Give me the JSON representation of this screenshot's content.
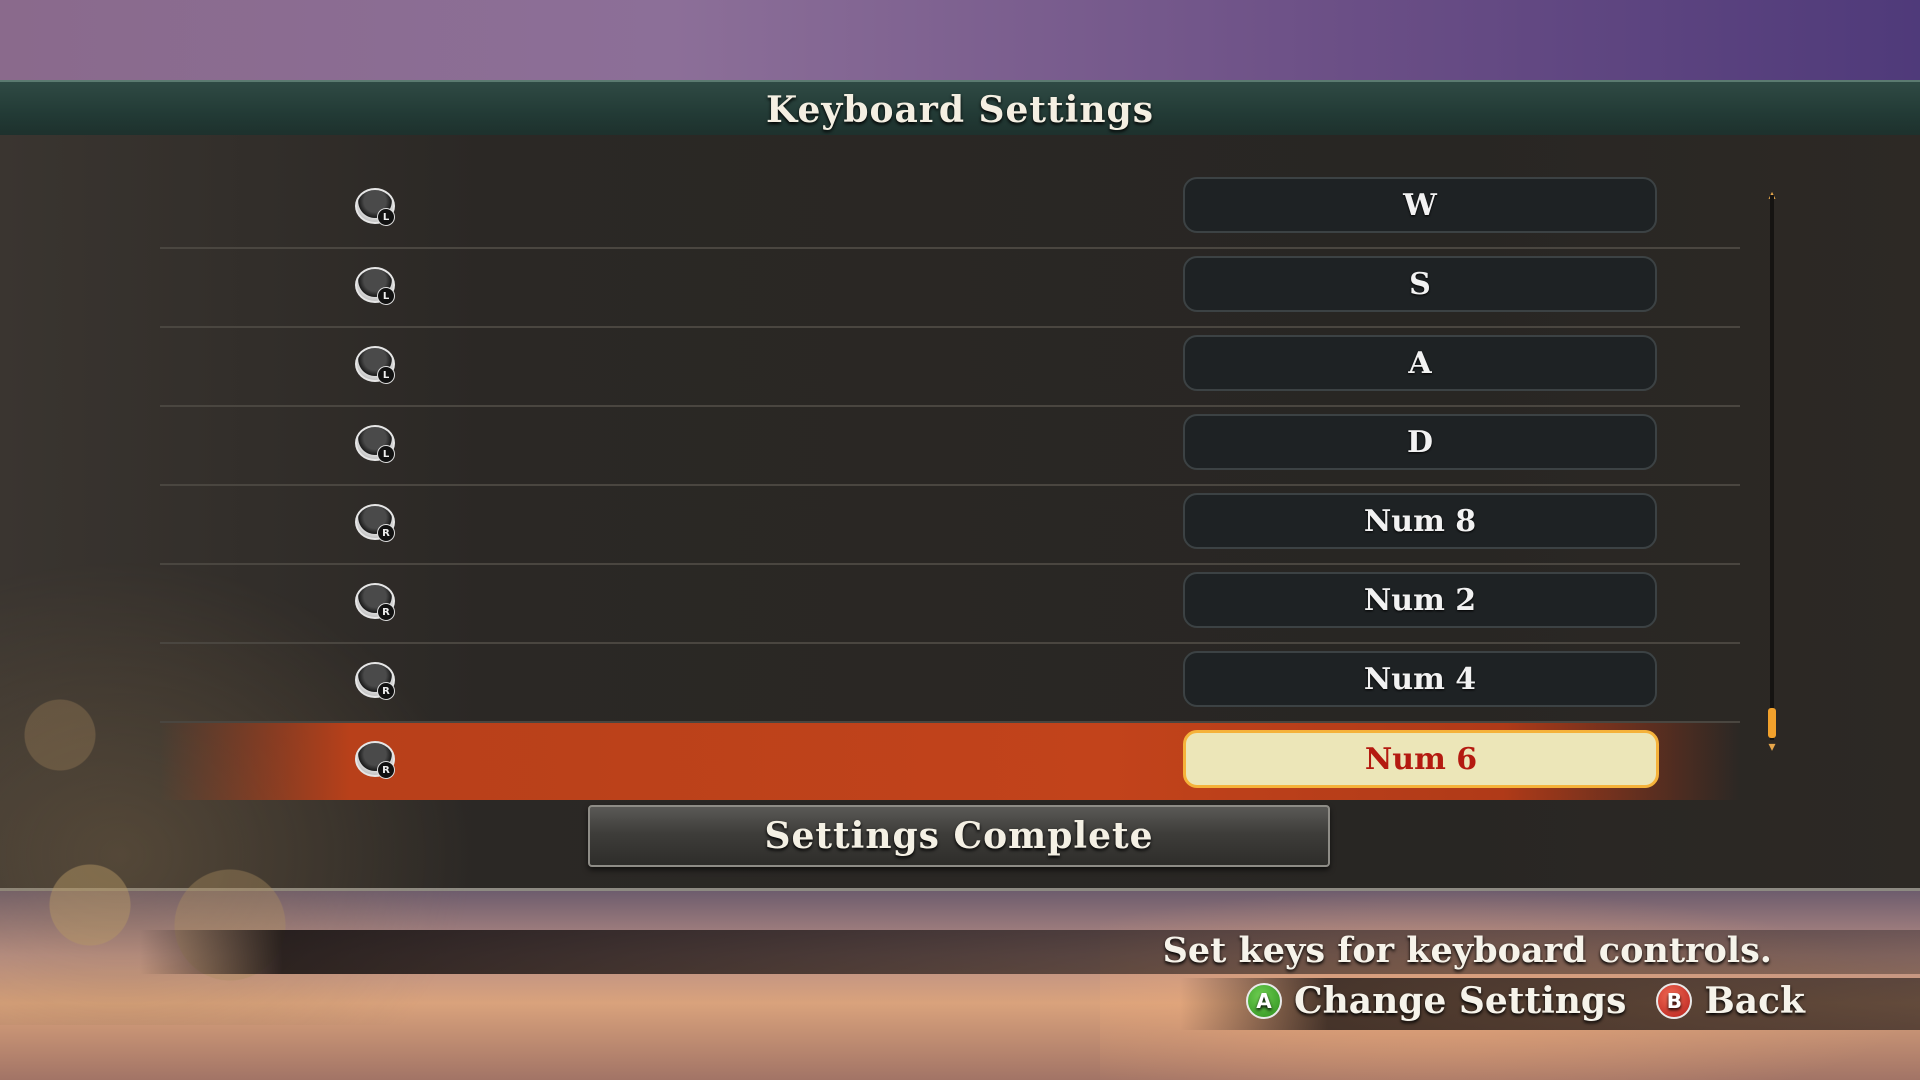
{
  "title": "Keyboard Settings",
  "rows": [
    {
      "stick": "L",
      "key": "W"
    },
    {
      "stick": "L",
      "key": "S"
    },
    {
      "stick": "L",
      "key": "A"
    },
    {
      "stick": "L",
      "key": "D"
    },
    {
      "stick": "R",
      "key": "Num 8"
    },
    {
      "stick": "R",
      "key": "Num 2"
    },
    {
      "stick": "R",
      "key": "Num 4"
    },
    {
      "stick": "R",
      "key": "Num 6"
    }
  ],
  "selected_row_index": 7,
  "complete_button": "Settings Complete",
  "help_text": "Set keys for keyboard controls.",
  "footer": {
    "a_button": "A",
    "a_label": "Change Settings",
    "b_button": "B",
    "b_label": "Back"
  },
  "colors": {
    "selected_row": "#c2431b",
    "selected_key_bg": "#ece6b8",
    "selected_key_text": "#b41a10",
    "title_bar": "#223a35",
    "scroll_thumb": "#f2a12c"
  },
  "icons": {
    "stick": "analog-stick-icon",
    "button_a": "a-button-icon",
    "button_b": "b-button-icon",
    "scroll_up": "scroll-up-arrow-icon",
    "scroll_down": "scroll-down-arrow-icon"
  }
}
